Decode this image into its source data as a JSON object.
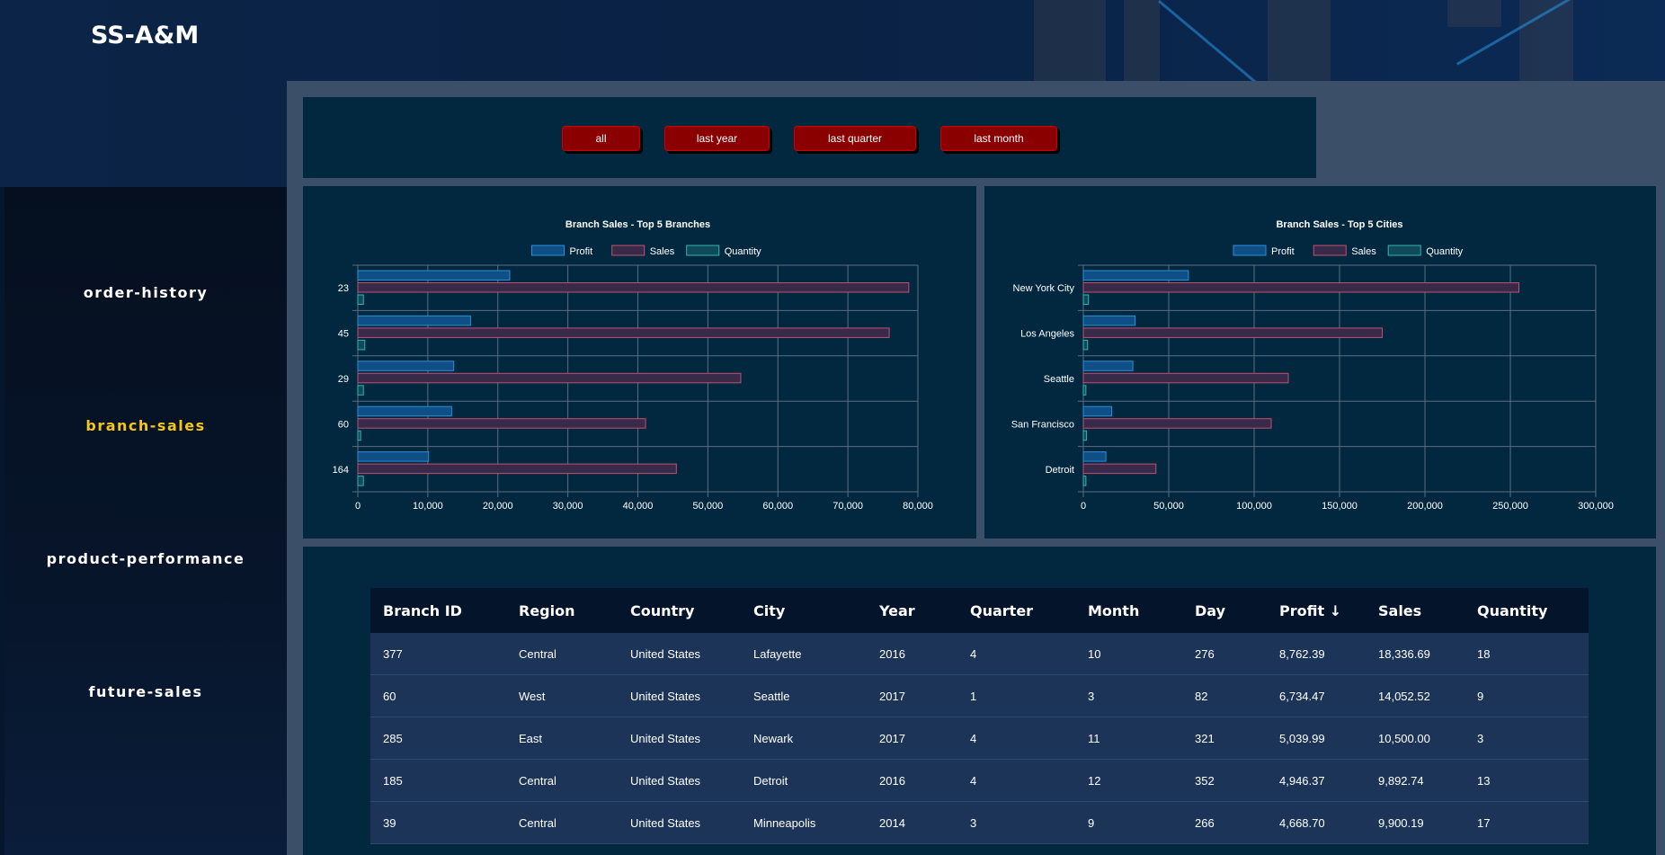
{
  "app": {
    "title": "SS-A&M"
  },
  "nav": [
    {
      "label": "order-history",
      "active": false
    },
    {
      "label": "branch-sales",
      "active": true
    },
    {
      "label": "product-performance",
      "active": false
    },
    {
      "label": "future-sales",
      "active": false
    }
  ],
  "filters": [
    "all",
    "last year",
    "last quarter",
    "last month"
  ],
  "colors": {
    "profit_fill": "#0f4f85",
    "profit_stroke": "#2a8fd6",
    "sales_fill": "#3a2a4a",
    "sales_stroke": "#c05070",
    "quantity_fill": "#0e4a5a",
    "quantity_stroke": "#36b0b0",
    "active_nav": "#f5c518",
    "button": "#8a0000"
  },
  "chart_data": [
    {
      "type": "bar",
      "orientation": "horizontal",
      "title": "Branch Sales - Top 5 Branches",
      "categories": [
        "23",
        "45",
        "29",
        "60",
        "164"
      ],
      "series": [
        {
          "name": "Profit",
          "values": [
            21700,
            16100,
            13700,
            13400,
            10100
          ]
        },
        {
          "name": "Sales",
          "values": [
            78700,
            75900,
            54700,
            41100,
            45500
          ]
        },
        {
          "name": "Quantity",
          "values": [
            800,
            1000,
            800,
            400,
            800
          ]
        }
      ],
      "xlim": [
        0,
        80000
      ],
      "xticks": [
        "0",
        "10,000",
        "20,000",
        "30,000",
        "40,000",
        "50,000",
        "60,000",
        "70,000",
        "80,000"
      ],
      "legend": "top",
      "grid": true
    },
    {
      "type": "bar",
      "orientation": "horizontal",
      "title": "Branch Sales - Top 5 Cities",
      "categories": [
        "New York City",
        "Los Angeles",
        "Seattle",
        "San Francisco",
        "Detroit"
      ],
      "series": [
        {
          "name": "Profit",
          "values": [
            61500,
            30300,
            29000,
            16600,
            13200
          ]
        },
        {
          "name": "Sales",
          "values": [
            255000,
            175000,
            120000,
            110000,
            42500
          ]
        },
        {
          "name": "Quantity",
          "values": [
            3000,
            2500,
            1500,
            1800,
            1500
          ]
        }
      ],
      "xlim": [
        0,
        300000
      ],
      "xticks": [
        "0",
        "50,000",
        "100,000",
        "150,000",
        "200,000",
        "250,000",
        "300,000"
      ],
      "legend": "top",
      "grid": true
    }
  ],
  "table": {
    "columns": [
      "Branch ID",
      "Region",
      "Country",
      "City",
      "Year",
      "Quarter",
      "Month",
      "Day",
      "Profit ↓",
      "Sales",
      "Quantity"
    ],
    "rows": [
      [
        "377",
        "Central",
        "United States",
        "Lafayette",
        "2016",
        "4",
        "10",
        "276",
        "8,762.39",
        "18,336.69",
        "18"
      ],
      [
        "60",
        "West",
        "United States",
        "Seattle",
        "2017",
        "1",
        "3",
        "82",
        "6,734.47",
        "14,052.52",
        "9"
      ],
      [
        "285",
        "East",
        "United States",
        "Newark",
        "2017",
        "4",
        "11",
        "321",
        "5,039.99",
        "10,500.00",
        "3"
      ],
      [
        "185",
        "Central",
        "United States",
        "Detroit",
        "2016",
        "4",
        "12",
        "352",
        "4,946.37",
        "9,892.74",
        "13"
      ],
      [
        "39",
        "Central",
        "United States",
        "Minneapolis",
        "2014",
        "3",
        "9",
        "266",
        "4,668.70",
        "9,900.19",
        "17"
      ]
    ]
  }
}
